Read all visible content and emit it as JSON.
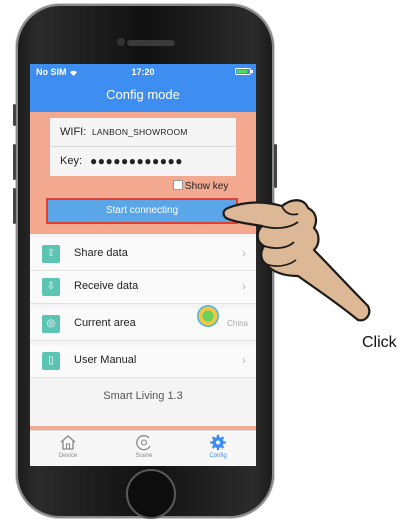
{
  "status_bar": {
    "carrier": "No SIM",
    "time": "17:20"
  },
  "navbar": {
    "title": "Config mode"
  },
  "form": {
    "wifi_label": "WIFI:",
    "wifi_value": "LANBON_SHOWROOM",
    "key_label": "Key:",
    "key_value": "●●●●●●●●●●●●"
  },
  "show_key_label": "Show key",
  "start_button_label": "Start connecting",
  "menu": {
    "share": "Share data",
    "receive": "Receive data",
    "area": "Current area",
    "area_value": "China",
    "manual": "User Manual"
  },
  "version": "Smart Living 1.3",
  "tabs": {
    "device": "Device",
    "scene": "Scene",
    "config": "Config"
  },
  "annotation": "Click",
  "colors": {
    "accent": "#3d8ef0",
    "panel": "#f2a98f",
    "button": "#5ba6e8",
    "icon_teal": "#5cc4b2"
  },
  "icons": [
    "wifi-icon",
    "battery-icon",
    "upload-icon",
    "download-icon",
    "globe-icon",
    "book-icon",
    "home-icon",
    "scene-icon",
    "gear-icon",
    "pointing-hand-icon"
  ]
}
